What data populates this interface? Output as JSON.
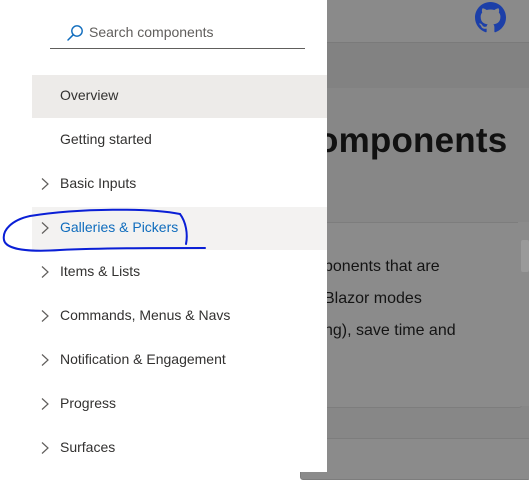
{
  "background": {
    "title_fragment": "omponents",
    "body_lines": [
      "ponents that are",
      "Blazor modes",
      "ng), save time and"
    ],
    "github_icon": "github-icon"
  },
  "search": {
    "placeholder": "Search components",
    "value": "",
    "icon": "search-icon"
  },
  "nav": {
    "items": [
      {
        "label": "Overview",
        "has_chevron": false,
        "state": "selected"
      },
      {
        "label": "Getting started",
        "has_chevron": false,
        "state": "normal"
      },
      {
        "label": "Basic Inputs",
        "has_chevron": true,
        "state": "normal"
      },
      {
        "label": "Galleries & Pickers",
        "has_chevron": true,
        "state": "hovered"
      },
      {
        "label": "Items & Lists",
        "has_chevron": true,
        "state": "normal"
      },
      {
        "label": "Commands, Menus & Navs",
        "has_chevron": true,
        "state": "normal"
      },
      {
        "label": "Notification & Engagement",
        "has_chevron": true,
        "state": "normal"
      },
      {
        "label": "Progress",
        "has_chevron": true,
        "state": "normal"
      },
      {
        "label": "Surfaces",
        "has_chevron": true,
        "state": "normal"
      }
    ]
  },
  "colors": {
    "accent": "#0f6cbd",
    "selected_bg": "#edebe9",
    "hover_bg": "#f3f2f1",
    "annotation_stroke": "#0a1fd6",
    "overlay_gray": "#8a8a8a"
  },
  "annotation": {
    "shape": "hand-drawn circle",
    "target": "Galleries & Pickers"
  }
}
